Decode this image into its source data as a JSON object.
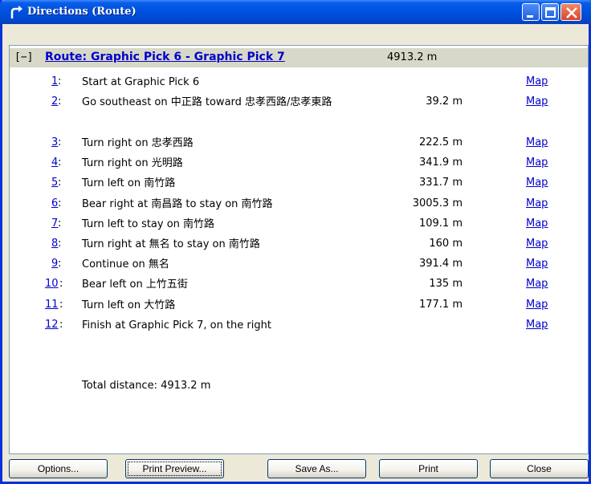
{
  "window": {
    "title": "Directions (Route)",
    "title_icon": "route-arrow-icon"
  },
  "route": {
    "toggle": "[−]",
    "title": "Route: Graphic Pick 6 - Graphic Pick 7",
    "distance": "4913.2 m"
  },
  "steps": [
    {
      "num": "1",
      "text": "Start at Graphic Pick 6",
      "distance": "",
      "map": "Map"
    },
    {
      "num": "2",
      "text": "Go southeast on 中正路 toward 忠孝西路/忠孝東路",
      "distance": "39.2 m",
      "map": "Map"
    },
    {
      "num": "3",
      "text": "Turn right on 忠孝西路",
      "distance": "222.5 m",
      "map": "Map"
    },
    {
      "num": "4",
      "text": "Turn right on 光明路",
      "distance": "341.9 m",
      "map": "Map"
    },
    {
      "num": "5",
      "text": "Turn left on 南竹路",
      "distance": "331.7 m",
      "map": "Map"
    },
    {
      "num": "6",
      "text": "Bear right at 南昌路 to stay on 南竹路",
      "distance": "3005.3 m",
      "map": "Map"
    },
    {
      "num": "7",
      "text": "Turn left to stay on 南竹路",
      "distance": "109.1 m",
      "map": "Map"
    },
    {
      "num": "8",
      "text": "Turn right at 無名 to stay on 南竹路",
      "distance": "160 m",
      "map": "Map"
    },
    {
      "num": "9",
      "text": "Continue on 無名",
      "distance": "391.4 m",
      "map": "Map"
    },
    {
      "num": "10",
      "text": "Bear left on 上竹五街",
      "distance": "135 m",
      "map": "Map"
    },
    {
      "num": "11",
      "text": "Turn left on 大竹路",
      "distance": "177.1 m",
      "map": "Map"
    },
    {
      "num": "12",
      "text": "Finish at Graphic Pick 7, on the right",
      "distance": "",
      "map": "Map"
    }
  ],
  "total": "Total distance: 4913.2 m",
  "buttons": {
    "options": "Options...",
    "print_preview": "Print Preview...",
    "save_as": "Save As...",
    "print": "Print",
    "close": "Close"
  }
}
